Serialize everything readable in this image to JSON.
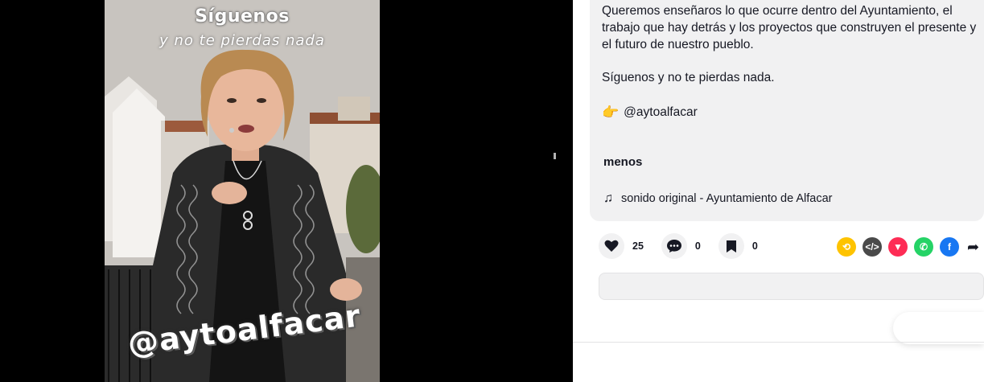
{
  "video": {
    "overlay_title": "Síguenos",
    "overlay_subtitle": "y no te pierdas nada",
    "overlay_handle": "@aytoalfacar"
  },
  "description": {
    "text": "Queremos enseñaros lo que ocurre dentro del Ayuntamiento, el trabajo que hay detrás y los proyectos que construyen el presente y el futuro de nuestro pueblo.",
    "follow_line": "Síguenos y no te pierdas nada.",
    "mention_icon": "backhand-index-pointing-right-icon",
    "mention": "@aytoalfacar",
    "less_label": "menos",
    "music_icon": "music-note-icon",
    "music": "sonido original - Ayuntamiento de Alfacar"
  },
  "actions": {
    "likes": "25",
    "comments": "0",
    "saves": "0"
  },
  "share": {
    "icons": [
      "repost-icon",
      "embed-icon",
      "send-icon",
      "whatsapp-icon",
      "facebook-icon",
      "share-arrow-icon"
    ],
    "colors": {
      "repost": "#fec300",
      "embed": "#4a4a4a",
      "send": "#fe2c55",
      "whatsapp": "#25d366",
      "facebook": "#1877f2"
    }
  }
}
